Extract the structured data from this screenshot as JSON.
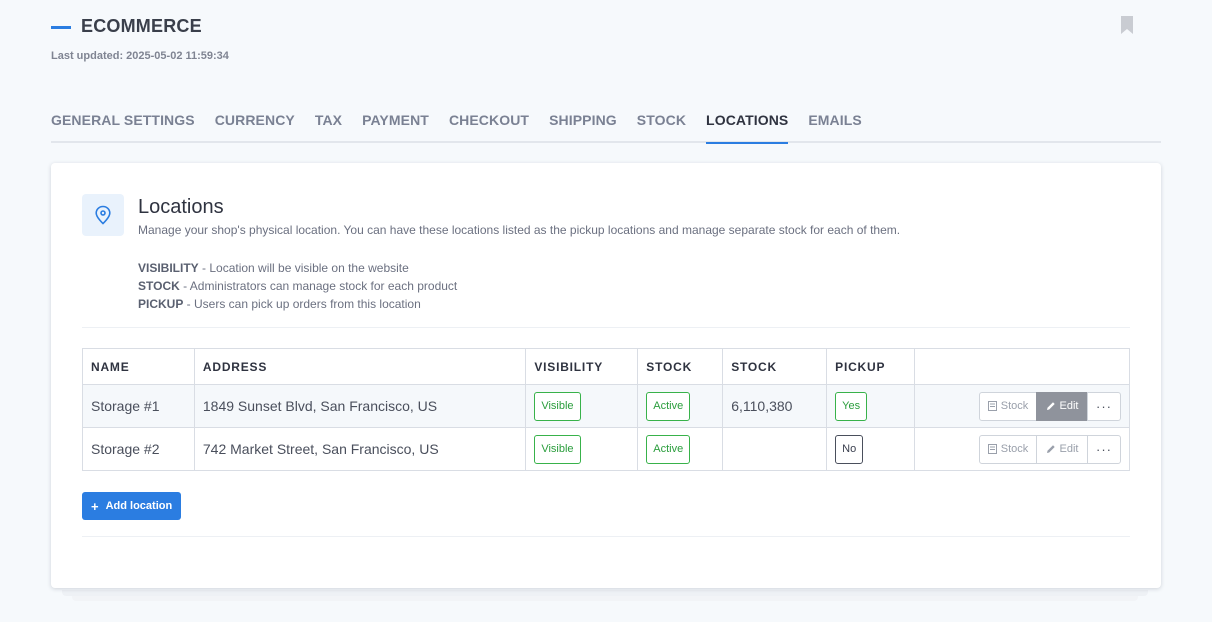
{
  "header": {
    "title": "ECOMMERCE",
    "last_updated": "Last updated: 2025-05-02 11:59:34"
  },
  "tabs": [
    {
      "label": "GENERAL SETTINGS",
      "active": false
    },
    {
      "label": "CURRENCY",
      "active": false
    },
    {
      "label": "TAX",
      "active": false
    },
    {
      "label": "PAYMENT",
      "active": false
    },
    {
      "label": "CHECKOUT",
      "active": false
    },
    {
      "label": "SHIPPING",
      "active": false
    },
    {
      "label": "STOCK",
      "active": false
    },
    {
      "label": "LOCATIONS",
      "active": true
    },
    {
      "label": "EMAILS",
      "active": false
    }
  ],
  "section": {
    "icon": "map-pin-icon",
    "title": "Locations",
    "description": "Manage your shop's physical location. You can have these locations listed as the pickup locations and manage separate stock for each of them.",
    "legend": [
      {
        "term": "VISIBILITY",
        "text": " - Location will be visible on the website"
      },
      {
        "term": "STOCK",
        "text": " - Administrators can manage stock for each product"
      },
      {
        "term": "PICKUP",
        "text": " - Users can pick up orders from this location"
      }
    ]
  },
  "table": {
    "columns": [
      "NAME",
      "ADDRESS",
      "VISIBILITY",
      "STOCK",
      "STOCK",
      "PICKUP",
      ""
    ],
    "rows": [
      {
        "name": "Storage #1",
        "address": "1849 Sunset Blvd, San Francisco, US",
        "visibility": "Visible",
        "stock_status": "Active",
        "stock_count": "6,110,380",
        "pickup": "Yes"
      },
      {
        "name": "Storage #2",
        "address": "742 Market Street, San Francisco, US",
        "visibility": "Visible",
        "stock_status": "Active",
        "stock_count": "",
        "pickup": "No"
      }
    ],
    "actions": {
      "stock_label": "Stock",
      "edit_label": "Edit",
      "more_label": "···"
    }
  },
  "add_button": {
    "label": "Add location"
  },
  "colors": {
    "accent": "#2b7de1",
    "success": "#38b24a",
    "background": "#f6f9fc"
  }
}
